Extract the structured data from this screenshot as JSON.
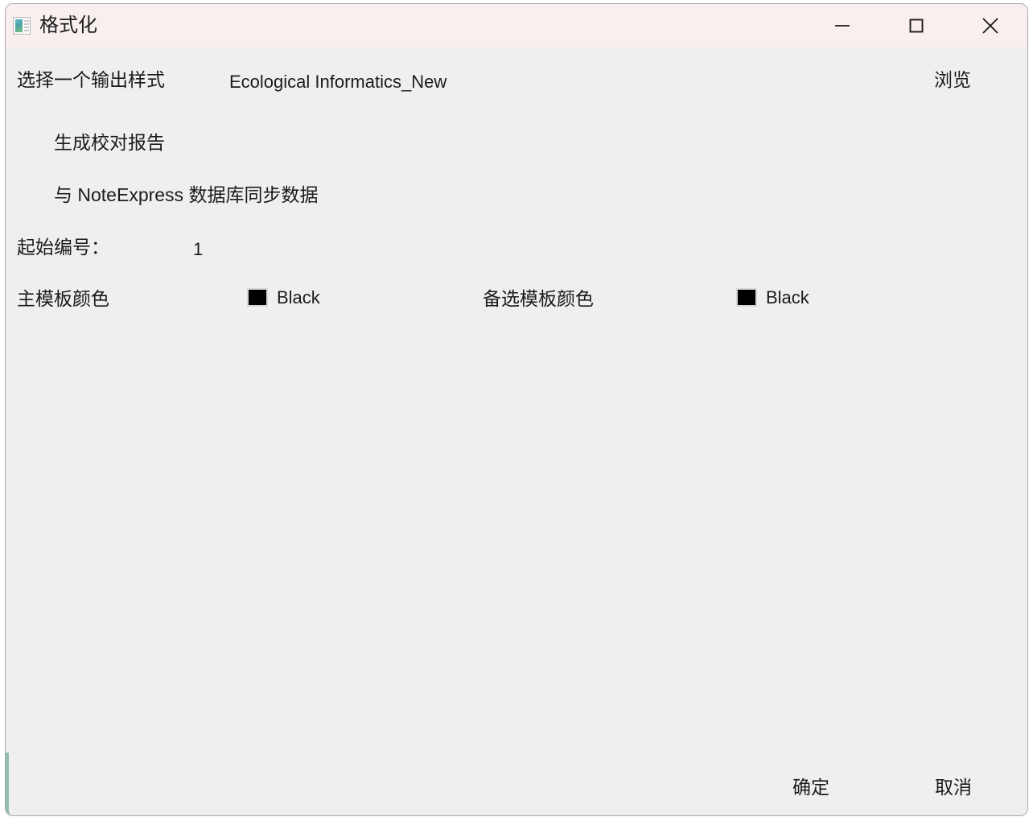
{
  "window": {
    "title": "格式化",
    "icon": "template-preview-icon",
    "accent_color": "#8fbfb0",
    "titlebar_color": "#f8efee",
    "client_color": "#efefef",
    "controls": [
      {
        "name": "minimize",
        "glyph": "minimize-icon"
      },
      {
        "name": "maximize",
        "glyph": "maximize-icon"
      },
      {
        "name": "close",
        "glyph": "close-icon"
      }
    ]
  },
  "form": {
    "style_label": "选择一个输出样式",
    "style_value": "Ecological Informatics_New",
    "browse_label": "浏览",
    "checkbox_report_label": "生成校对报告",
    "checkbox_sync_label": "与 NoteExpress 数据库同步数据",
    "start_number_label": "起始编号：",
    "start_number_value": "1",
    "main_color_label": "主模板颜色",
    "main_color_value": "Black",
    "main_color_hex": "#000000",
    "alt_color_label": "备选模板颜色",
    "alt_color_value": "Black",
    "alt_color_hex": "#000000"
  },
  "footer": {
    "ok_label": "确定",
    "cancel_label": "取消"
  }
}
